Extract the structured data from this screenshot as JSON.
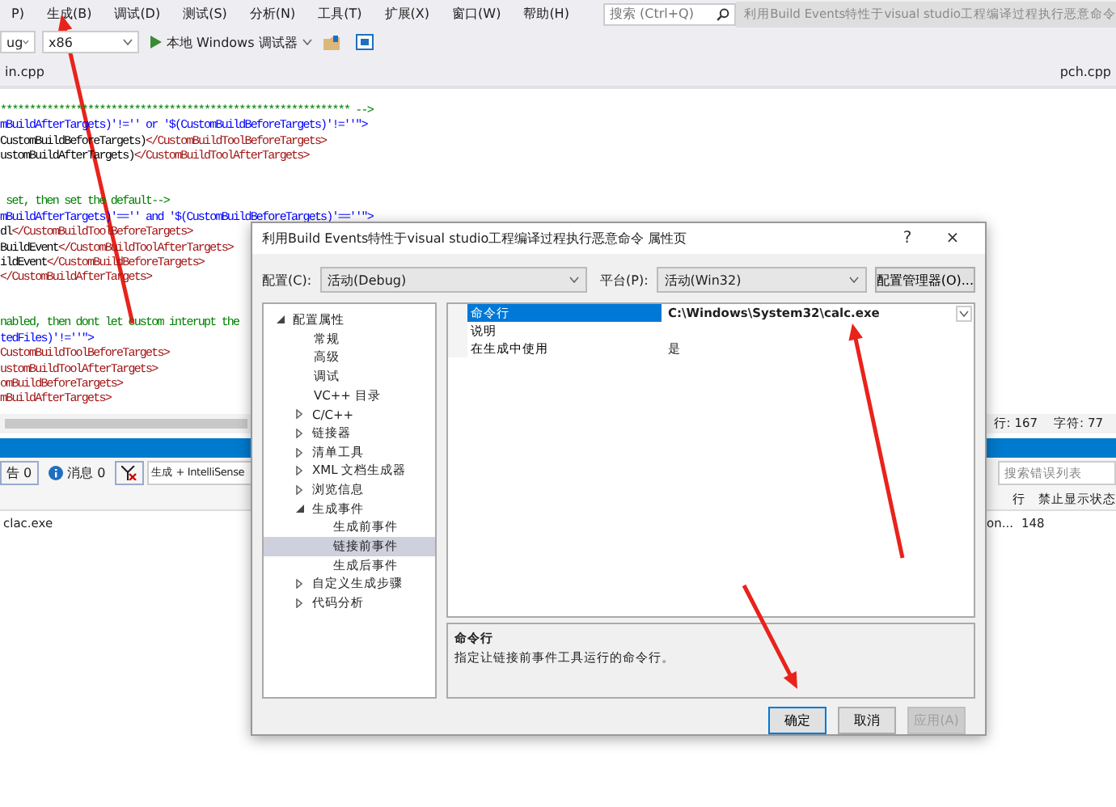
{
  "menu": [
    "P)",
    "生成(B)",
    "调试(D)",
    "测试(S)",
    "分析(N)",
    "工具(T)",
    "扩展(X)",
    "窗口(W)",
    "帮助(H)"
  ],
  "search": {
    "placeholder": "搜索 (Ctrl+Q)"
  },
  "window_title": "利用Build Events特性于visual studio工程编译过程执行恶意命令",
  "toolbar": {
    "configuration": "ug",
    "platform": "x86",
    "debugger": "本地 Windows 调试器"
  },
  "editor_tabs": [
    "in.cpp",
    "pch.cpp"
  ],
  "code_lines": [
    {
      "kind": "code",
      "segments": [
        {
          "kind": "comment",
          "text": "************************************************************ -->"
        }
      ]
    },
    {
      "kind": "code",
      "segments": [
        {
          "kind": "attr",
          "text": "mBuildAfterTargets)'!='' or '$(CustomBuildBeforeTargets)'!=''\">"
        }
      ]
    },
    {
      "kind": "code",
      "segments": [
        {
          "kind": "text",
          "text": "CustomBuildBeforeTargets)"
        },
        {
          "kind": "tag",
          "text": "</CustomBuildToolBeforeTargets>"
        }
      ]
    },
    {
      "kind": "code",
      "segments": [
        {
          "kind": "text",
          "text": "ustomBuildAfterTargets)"
        },
        {
          "kind": "tag",
          "text": "</CustomBuildToolAfterTargets>"
        }
      ]
    },
    {
      "kind": "blank"
    },
    {
      "kind": "blank"
    },
    {
      "kind": "code",
      "segments": [
        {
          "kind": "comment",
          "text": " set, then set the default-->"
        }
      ]
    },
    {
      "kind": "code",
      "segments": [
        {
          "kind": "attr",
          "text": "mBuildAfterTargets)'=='' and '$(CustomBuildBeforeTargets)'==''\">"
        }
      ]
    },
    {
      "kind": "code",
      "segments": [
        {
          "kind": "text",
          "text": "dl"
        },
        {
          "kind": "tag",
          "text": "</CustomBuildToolBeforeTargets>"
        }
      ]
    },
    {
      "kind": "code",
      "segments": [
        {
          "kind": "text",
          "text": "BuildEvent"
        },
        {
          "kind": "tag",
          "text": "</CustomBuildToolAfterTargets>"
        }
      ]
    },
    {
      "kind": "code",
      "segments": [
        {
          "kind": "text",
          "text": "ildEvent"
        },
        {
          "kind": "tag",
          "text": "</CustomBuildBeforeTargets>"
        }
      ]
    },
    {
      "kind": "code",
      "segments": [
        {
          "kind": "tag",
          "text": "</CustomBuildAfterTargets>"
        }
      ]
    },
    {
      "kind": "blank"
    },
    {
      "kind": "blank"
    },
    {
      "kind": "code",
      "segments": [
        {
          "kind": "comment",
          "text": "nabled, then dont let custom interupt the"
        }
      ]
    },
    {
      "kind": "code",
      "segments": [
        {
          "kind": "attr",
          "text": "tedFiles)'!=''\">"
        }
      ]
    },
    {
      "kind": "code",
      "segments": [
        {
          "kind": "tag",
          "text": "CustomBuildToolBeforeTargets>"
        }
      ]
    },
    {
      "kind": "code",
      "segments": [
        {
          "kind": "tag",
          "text": "ustomBuildToolAfterTargets>"
        }
      ]
    },
    {
      "kind": "code",
      "segments": [
        {
          "kind": "tag",
          "text": "omBuildBeforeTargets>"
        }
      ]
    },
    {
      "kind": "code",
      "segments": [
        {
          "kind": "tag",
          "text": "mBuildAfterTargets>"
        }
      ]
    }
  ],
  "status": {
    "line": "行: 167",
    "column": "字符: 77"
  },
  "error_list": {
    "warnings": "告 0",
    "messages": "消息 0",
    "filter": "生成 + IntelliSense",
    "search_placeholder": "搜索错误列表",
    "columns": [
      "行",
      "禁止显示状态"
    ],
    "rows": [
      {
        "description": "clac.exe",
        "file": "on...",
        "line": "148"
      }
    ]
  },
  "dialog": {
    "title": "利用Build Events特性于visual studio工程编译过程执行恶意命令 属性页",
    "help": "?",
    "close": "×",
    "configuration_label": "配置(C):",
    "configuration": "活动(Debug)",
    "platform_label": "平台(P):",
    "platform": "活动(Win32)",
    "manager_button": "配置管理器(O)...",
    "tree": [
      {
        "label": "配置属性",
        "expanded": true,
        "selected": false,
        "children": [
          {
            "label": "常规",
            "selected": false
          },
          {
            "label": "高级",
            "selected": false
          },
          {
            "label": "调试",
            "selected": false
          },
          {
            "label": "VC++ 目录",
            "selected": false
          },
          {
            "label": "C/C++",
            "expanded": false,
            "selected": false
          },
          {
            "label": "链接器",
            "expanded": false,
            "selected": false
          },
          {
            "label": "清单工具",
            "expanded": false,
            "selected": false
          },
          {
            "label": "XML 文档生成器",
            "expanded": false,
            "selected": false
          },
          {
            "label": "浏览信息",
            "expanded": false,
            "selected": false
          },
          {
            "label": "生成事件",
            "expanded": true,
            "selected": false,
            "children": [
              {
                "label": "生成前事件",
                "selected": false
              },
              {
                "label": "链接前事件",
                "selected": true
              },
              {
                "label": "生成后事件",
                "selected": false
              }
            ]
          },
          {
            "label": "自定义生成步骤",
            "expanded": false,
            "selected": false
          },
          {
            "label": "代码分析",
            "expanded": false,
            "selected": false
          }
        ]
      }
    ],
    "properties": [
      {
        "name": "命令行",
        "value": "C:\\Windows\\System32\\calc.exe",
        "selected": true
      },
      {
        "name": "说明",
        "selected": false
      },
      {
        "name": "在生成中使用",
        "value": "是",
        "selected": false
      }
    ],
    "description": {
      "title": "命令行",
      "text": "指定让链接前事件工具运行的命令行。"
    },
    "buttons": [
      {
        "label": "确定",
        "kind": "default",
        "disabled": false
      },
      {
        "label": "取消",
        "kind": "normal",
        "disabled": false
      },
      {
        "label": "应用(A)",
        "kind": "normal",
        "disabled": true
      }
    ]
  }
}
